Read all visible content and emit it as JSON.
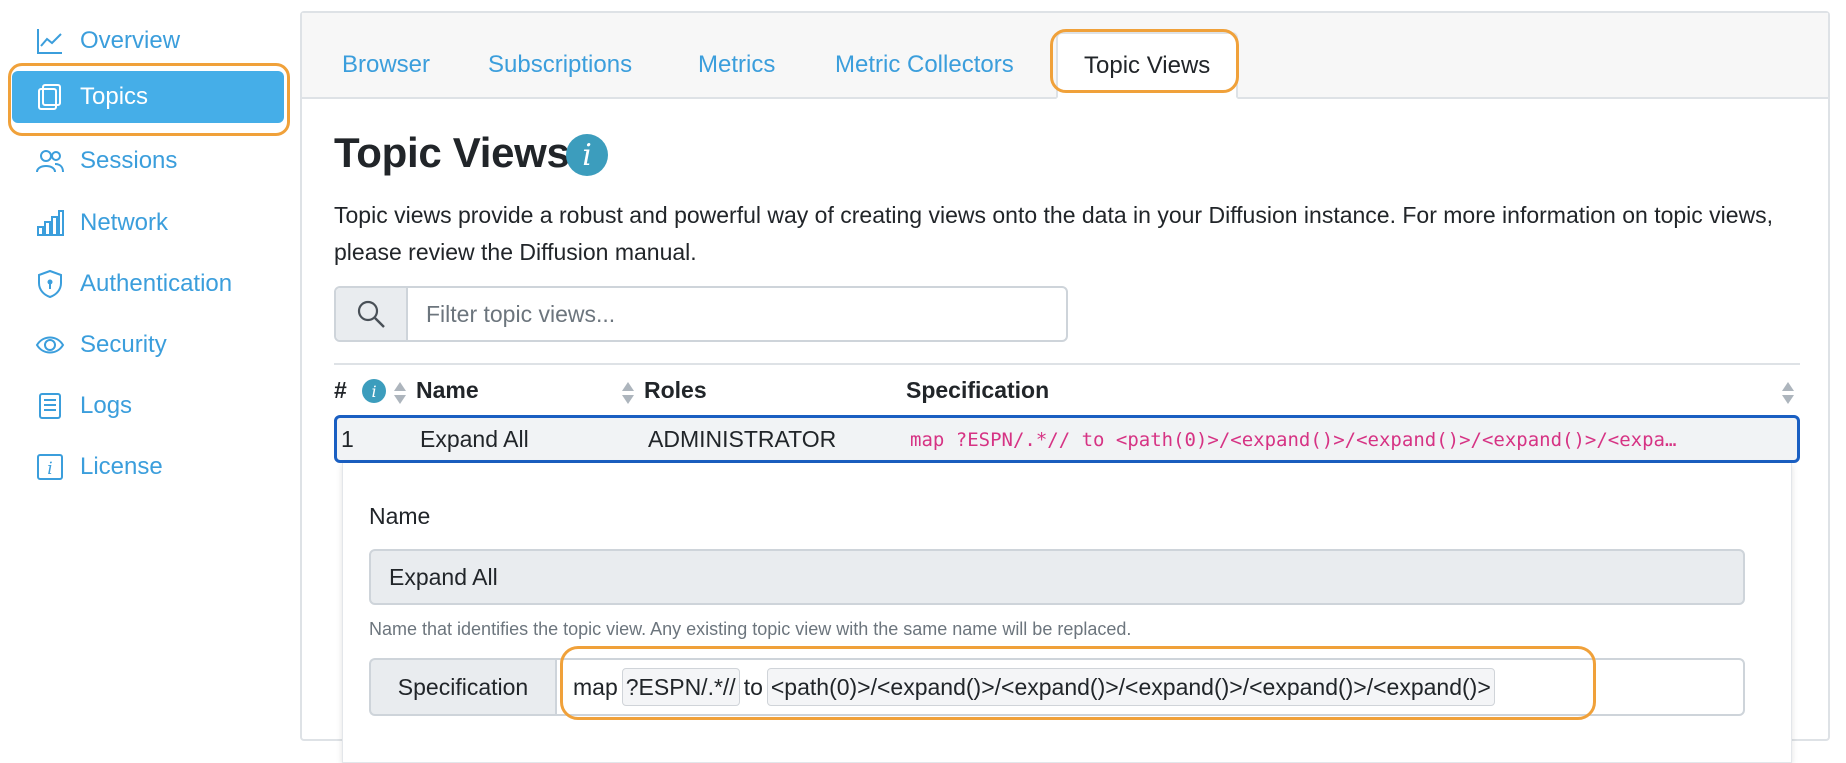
{
  "sidebar": {
    "items": [
      {
        "label": "Overview",
        "icon": "chart-line-icon"
      },
      {
        "label": "Topics",
        "icon": "copy-pages-icon",
        "active": true
      },
      {
        "label": "Sessions",
        "icon": "people-icon"
      },
      {
        "label": "Network",
        "icon": "bar-chart-icon"
      },
      {
        "label": "Authentication",
        "icon": "shield-keyhole-icon"
      },
      {
        "label": "Security",
        "icon": "eye-icon"
      },
      {
        "label": "Logs",
        "icon": "document-icon"
      },
      {
        "label": "License",
        "icon": "info-square-icon"
      }
    ]
  },
  "tabs": [
    {
      "label": "Browser"
    },
    {
      "label": "Subscriptions"
    },
    {
      "label": "Metrics"
    },
    {
      "label": "Metric Collectors"
    },
    {
      "label": "Topic Views",
      "active": true
    }
  ],
  "page": {
    "title": "Topic Views",
    "info_glyph": "i",
    "description": "Topic views provide a robust and powerful way of creating views onto the data in your Diffusion instance. For more information on topic views, please review the Diffusion manual."
  },
  "filter": {
    "placeholder": "Filter topic views..."
  },
  "table": {
    "headers": {
      "index": "#",
      "name": "Name",
      "roles": "Roles",
      "specification": "Specification"
    },
    "rows": [
      {
        "index": "1",
        "name": "Expand All",
        "roles": "ADMINISTRATOR",
        "specification": "map ?ESPN/.*// to <path(0)>/<expand()>/<expand()>/<expand()>/<expand()>/<expand()>"
      }
    ]
  },
  "detail": {
    "name_label": "Name",
    "name_value": "Expand All",
    "name_help": "Name that identifies the topic view. Any existing topic view with the same name will be replaced.",
    "spec_label": "Specification",
    "spec_parts": {
      "keyword_map": "map",
      "selector": "?ESPN/.*//",
      "keyword_to": "to",
      "target": "<path(0)>/<expand()>/<expand()>/<expand()>/<expand()>/<expand()>"
    }
  },
  "colors": {
    "accent": "#3b9edc",
    "active_nav": "#45aee8",
    "highlight_orange": "#f0a13a",
    "selected_row_border": "#1a5fc2",
    "code_pink": "#d63384",
    "info_badge": "#3c9dbd"
  }
}
